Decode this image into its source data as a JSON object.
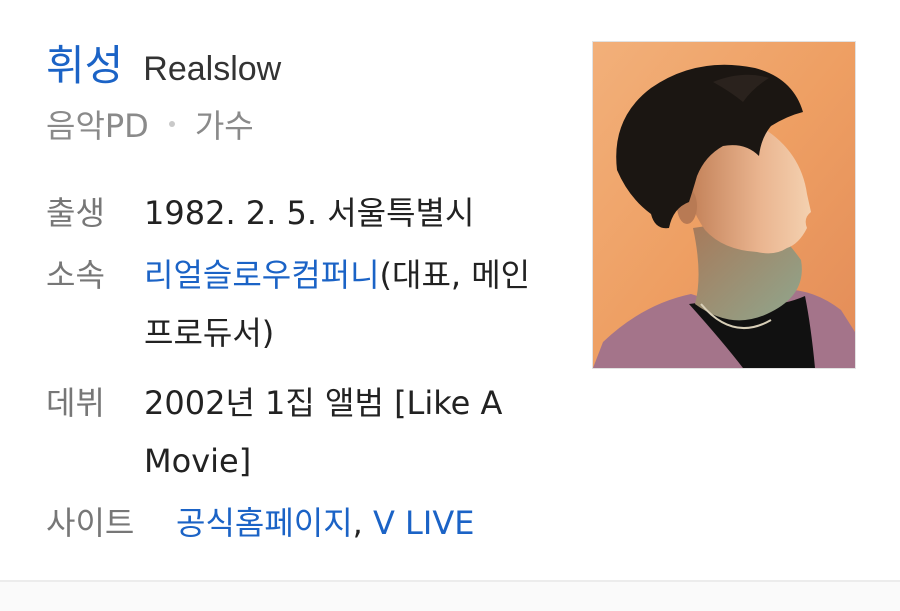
{
  "profile": {
    "name": "휘성",
    "alt_name": "Realslow",
    "roles": [
      "음악PD",
      "가수"
    ],
    "photo_icon": "person-photo"
  },
  "info": {
    "birth": {
      "label": "출생",
      "value": "1982. 2. 5. 서울특별시"
    },
    "agency": {
      "label": "소속",
      "link": "리얼슬로우컴퍼니",
      "note": "(대표, 메인 프로듀서)"
    },
    "debut": {
      "label": "데뷔",
      "value": "2002년 1집 앨범 [Like A Movie]"
    },
    "site": {
      "label": "사이트",
      "links": [
        "공식홈페이지",
        "V LIVE"
      ],
      "separator": ", "
    }
  },
  "colors": {
    "link": "#1b63c6",
    "label": "#777777",
    "text": "#222222"
  }
}
